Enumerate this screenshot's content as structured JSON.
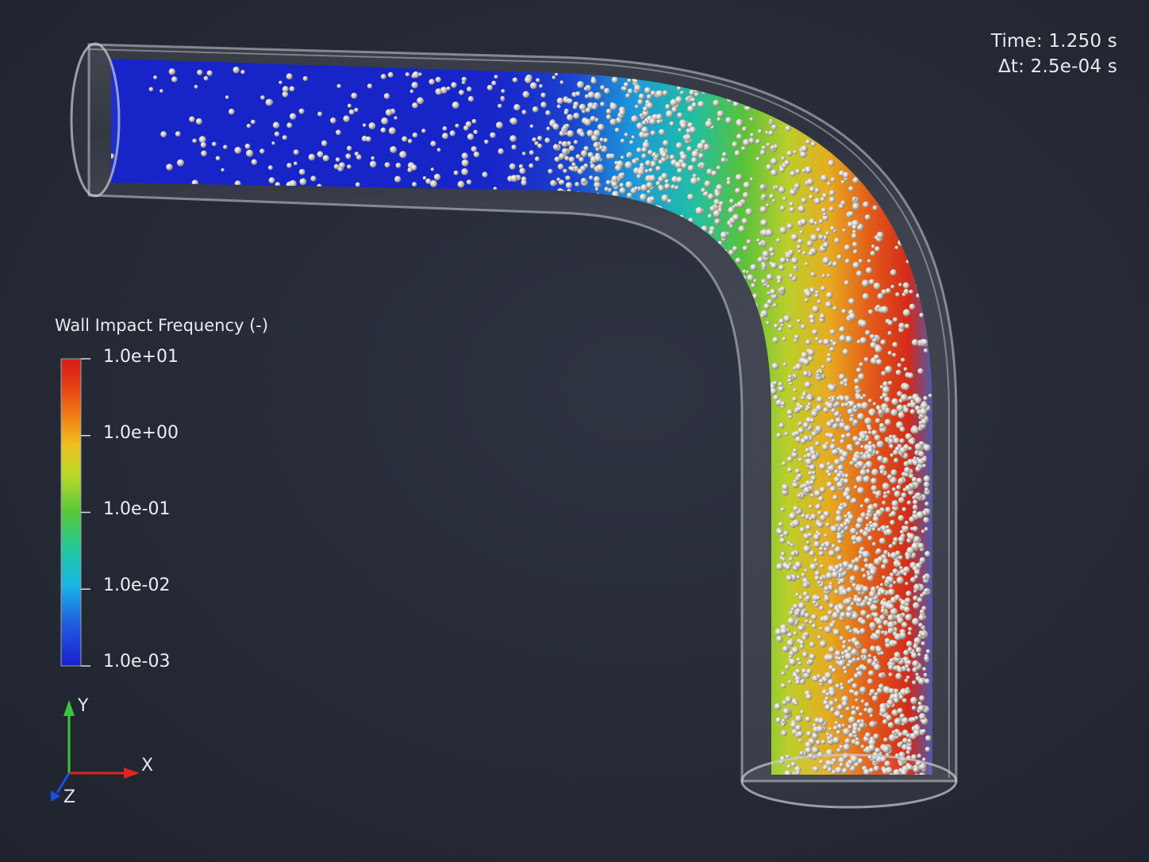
{
  "hud": {
    "time_label": "Time: 1.250 s",
    "dt_label": "Δt: 2.5e-04 s"
  },
  "legend": {
    "title": "Wall Impact Frequency (-)",
    "ticks": [
      "1.0e+01",
      "1.0e+00",
      "1.0e-01",
      "1.0e-02",
      "1.0e-03"
    ],
    "colormap": [
      "#1a1fd0",
      "#1f5ee0",
      "#19b4e8",
      "#20c99a",
      "#57c83a",
      "#b7d82a",
      "#f0c01f",
      "#f07a16",
      "#e43a14",
      "#d81c1c"
    ]
  },
  "axes": {
    "x_label": "X",
    "y_label": "Y",
    "z_label": "Z",
    "colors": {
      "x": "#e3231f",
      "y": "#39c63a",
      "z": "#1f4de3"
    }
  }
}
